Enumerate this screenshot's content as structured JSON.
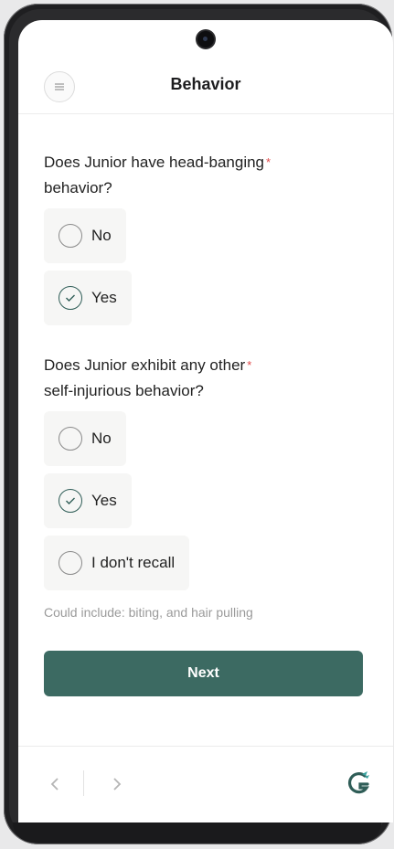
{
  "header": {
    "title": "Behavior"
  },
  "questions": [
    {
      "text": "Does Junior have head-banging",
      "text2": "behavior?",
      "required_mark": "*",
      "options": [
        {
          "label": "No",
          "checked": false
        },
        {
          "label": "Yes",
          "checked": true
        }
      ]
    },
    {
      "text": "Does Junior exhibit any other",
      "text2": "self-injurious behavior?",
      "required_mark": "*",
      "options": [
        {
          "label": "No",
          "checked": false
        },
        {
          "label": "Yes",
          "checked": true
        },
        {
          "label": "I don't recall",
          "checked": false
        }
      ],
      "hint": "Could include: biting, and hair pulling"
    }
  ],
  "actions": {
    "next_label": "Next"
  },
  "footer": {
    "prev_icon": "chevron-left-icon",
    "next_icon": "chevron-right-icon",
    "logo_icon": "brand-logo-icon"
  },
  "colors": {
    "accent": "#3c6a62",
    "required": "#e04848",
    "option_bg": "#f6f6f5"
  }
}
